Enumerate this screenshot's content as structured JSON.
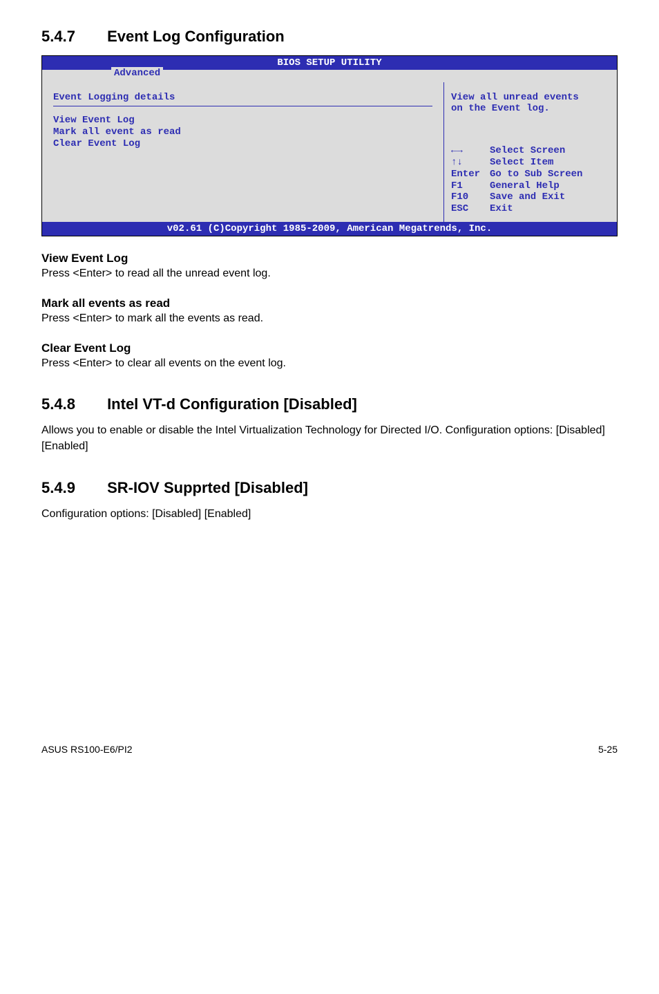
{
  "section547": {
    "number": "5.4.7",
    "title": "Event Log Configuration"
  },
  "bios": {
    "title": "BIOS SETUP UTILITY",
    "tab": "Advanced",
    "left_title": "Event Logging details",
    "left_items": [
      "View Event Log",
      "Mark all event as read",
      "Clear Event Log"
    ],
    "help_line1": "View all unread events",
    "help_line2": "on the Event log.",
    "keys": {
      "k1_sym": "←→",
      "k1_label": "Select Screen",
      "k2_sym": "↑↓",
      "k2_label": "Select Item",
      "k3_sym": "Enter",
      "k3_label": "Go to Sub Screen",
      "k4_sym": "F1",
      "k4_label": "General Help",
      "k5_sym": "F10",
      "k5_label": "Save and Exit",
      "k6_sym": "ESC",
      "k6_label": "Exit"
    },
    "footer": "v02.61 (C)Copyright 1985-2009, American Megatrends, Inc."
  },
  "view_event_log": {
    "head": "View Event Log",
    "text": "Press <Enter> to read all the unread event log."
  },
  "mark_all": {
    "head": "Mark all events as read",
    "text": "Press <Enter> to mark all the events as read."
  },
  "clear_event": {
    "head": "Clear Event Log",
    "text": "Press <Enter> to clear all events on the event log."
  },
  "section548": {
    "number": "5.4.8",
    "title": "Intel VT-d Configuration [Disabled]",
    "text": "Allows you to enable or disable the Intel Virtualization Technology for Directed I/O. Configuration options: [Disabled] [Enabled]"
  },
  "section549": {
    "number": "5.4.9",
    "title": "SR-IOV Supprted [Disabled]",
    "text": "Configuration options: [Disabled] [Enabled]"
  },
  "footer": {
    "left": "ASUS RS100-E6/PI2",
    "right": "5-25"
  }
}
